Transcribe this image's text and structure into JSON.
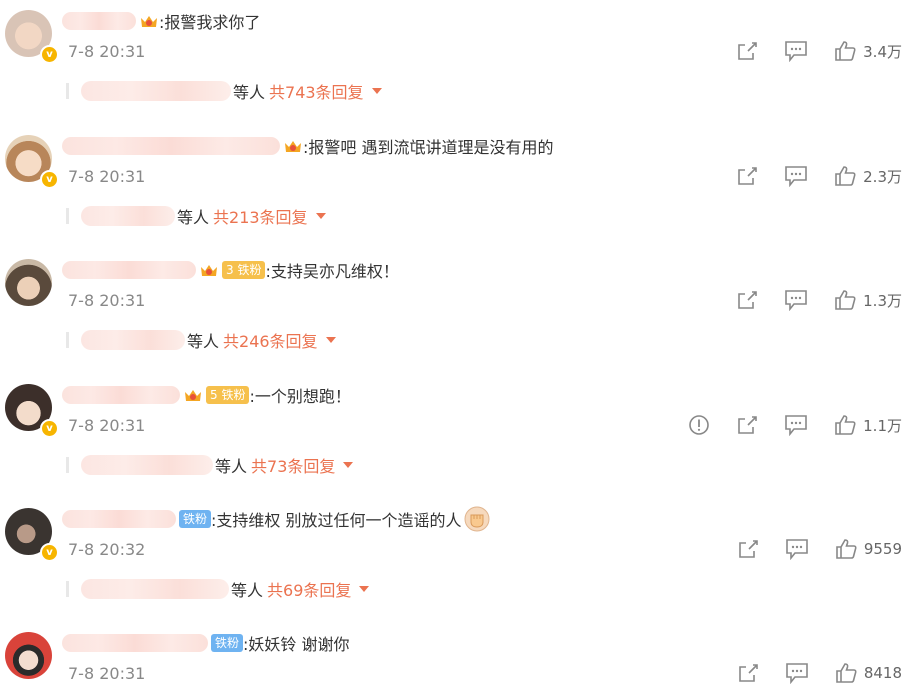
{
  "comments": [
    {
      "text": ":报警我求你了",
      "time": "7-8 20:31",
      "likes": "3.4万",
      "reply_prefix": "等人",
      "reply_count": "共743条回复",
      "fan_badge": ""
    },
    {
      "text": ":报警吧 遇到流氓讲道理是没有用的",
      "time": "7-8 20:31",
      "likes": "2.3万",
      "reply_prefix": "等人",
      "reply_count": "共213条回复",
      "fan_badge": ""
    },
    {
      "text": ":支持吴亦凡维权！",
      "time": "7-8 20:31",
      "likes": "1.3万",
      "reply_prefix": "等人",
      "reply_count": "共246条回复",
      "fan_badge": "铁粉",
      "fan_level": "3"
    },
    {
      "text": ":一个别想跑！",
      "time": "7-8 20:31",
      "likes": "1.1万",
      "reply_prefix": "等人",
      "reply_count": "共73条回复",
      "fan_badge": "铁粉",
      "fan_level": "5"
    },
    {
      "text": ":支持维权 别放过任何一个造谣的人",
      "time": "7-8 20:32",
      "likes": "9559",
      "reply_prefix": "等人",
      "reply_count": "共69条回复",
      "fan_badge": "铁粉"
    },
    {
      "text": ":妖妖铃 谢谢你",
      "time": "7-8 20:31",
      "likes": "8418",
      "fan_badge": "铁粉"
    }
  ],
  "colors": {
    "accent": "#eb7350",
    "verified": "#f7b500",
    "fan_gold": "#f6c04c",
    "fan_blue": "#6fb3f1"
  },
  "icons": [
    "share-icon",
    "comment-icon",
    "like-icon",
    "report-icon",
    "vip-crown-icon",
    "fist-emoji"
  ]
}
